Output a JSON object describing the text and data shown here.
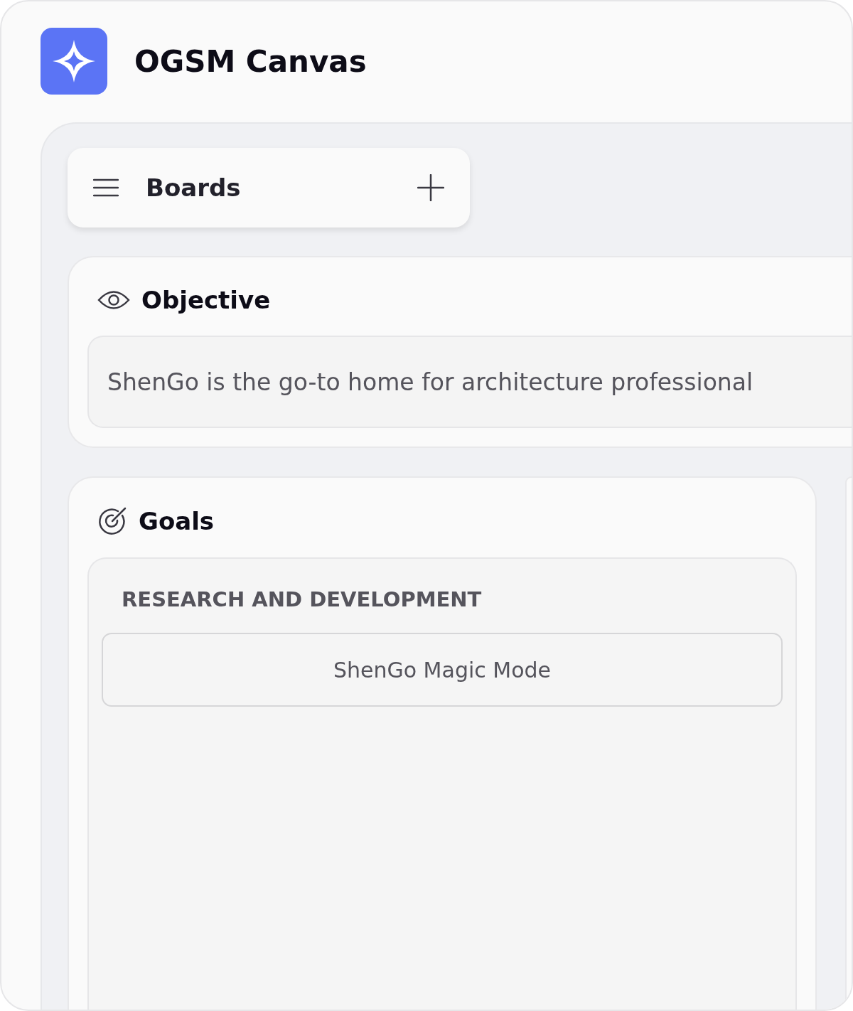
{
  "app": {
    "title": "OGSM Canvas"
  },
  "boards": {
    "title": "Boards"
  },
  "objective": {
    "title": "Objective",
    "text": "ShenGo is the go-to home for architecture professional"
  },
  "goals": {
    "title": "Goals",
    "groups": [
      {
        "title": "RESEARCH AND DEVELOPMENT",
        "items": [
          "ShenGo Magic Mode"
        ]
      }
    ]
  }
}
